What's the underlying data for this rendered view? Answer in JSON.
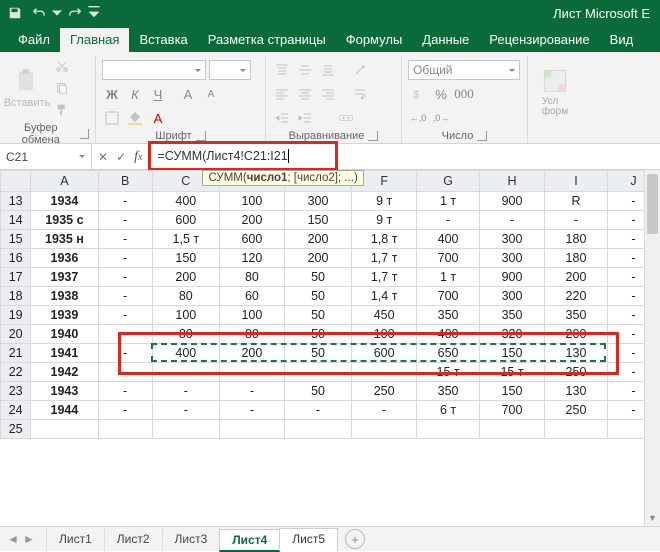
{
  "app": {
    "title": "Лист Microsoft E"
  },
  "qat": {
    "save": "save-icon",
    "undo": "undo-icon",
    "redo": "redo-icon",
    "customize": "customize-icon"
  },
  "tabs": {
    "file": "Файл",
    "home": "Главная",
    "insert": "Вставка",
    "layout": "Разметка страницы",
    "formulas": "Формулы",
    "data": "Данные",
    "review": "Рецензирование",
    "view": "Вид"
  },
  "ribbon": {
    "clipboard": {
      "label": "Буфер обмена",
      "paste": "Вставить"
    },
    "font": {
      "label": "Шрифт",
      "size_dash": "–",
      "bold": "Ж",
      "italic": "К",
      "underline": "Ч"
    },
    "alignment": {
      "label": "Выравнивание"
    },
    "number": {
      "label": "Число",
      "format": "Общий"
    },
    "styles": {
      "cond": "Условн форматир"
    }
  },
  "formula_bar": {
    "name_box": "C21",
    "formula": "=СУММ(Лист4!C21:I21",
    "tooltip_fn": "СУММ",
    "tooltip_arg1": "число1",
    "tooltip_rest": "; [число2]; ...)"
  },
  "columns": [
    "",
    "A",
    "B",
    "C",
    "D",
    "E",
    "F",
    "G",
    "H",
    "I",
    "J"
  ],
  "rows": [
    {
      "n": 13,
      "c": [
        "1934",
        "-",
        "400",
        "100",
        "300",
        "9 т",
        "1 т",
        "900",
        "R",
        "-"
      ]
    },
    {
      "n": 14,
      "c": [
        "1935 с",
        "-",
        "600",
        "200",
        "150",
        "9 т",
        "-",
        "-",
        "-",
        "-"
      ]
    },
    {
      "n": 15,
      "c": [
        "1935 н",
        "-",
        "1,5 т",
        "600",
        "200",
        "1,8 т",
        "400",
        "300",
        "180",
        "-"
      ]
    },
    {
      "n": 16,
      "c": [
        "1936",
        "-",
        "150",
        "120",
        "200",
        "1,7 т",
        "700",
        "300",
        "180",
        "-"
      ]
    },
    {
      "n": 17,
      "c": [
        "1937",
        "-",
        "200",
        "80",
        "50",
        "1,7 т",
        "1 т",
        "900",
        "200",
        "-"
      ]
    },
    {
      "n": 18,
      "c": [
        "1938",
        "-",
        "80",
        "60",
        "50",
        "1,4 т",
        "700",
        "300",
        "220",
        "-"
      ]
    },
    {
      "n": 19,
      "c": [
        "1939",
        "-",
        "100",
        "100",
        "50",
        "450",
        "350",
        "350",
        "350",
        "-"
      ]
    },
    {
      "n": 20,
      "c": [
        "1940",
        "-",
        "80",
        "80",
        "50",
        "100",
        "400",
        "320",
        "200",
        "-"
      ]
    },
    {
      "n": 21,
      "c": [
        "1941",
        "-",
        "400",
        "200",
        "50",
        "600",
        "650",
        "150",
        "130",
        "-"
      ]
    },
    {
      "n": 22,
      "c": [
        "1942",
        "-",
        "",
        "",
        "",
        "",
        "15 т",
        "15 т",
        "250",
        "-"
      ]
    },
    {
      "n": 23,
      "c": [
        "1943",
        "-",
        "-",
        "-",
        "50",
        "250",
        "350",
        "150",
        "130",
        "-"
      ]
    },
    {
      "n": 24,
      "c": [
        "1944",
        "-",
        "-",
        "-",
        "-",
        "-",
        "6 т",
        "700",
        "250",
        "-"
      ]
    },
    {
      "n": 25,
      "c": [
        "",
        "",
        "",
        "",
        "",
        "",
        "",
        "",
        "",
        ""
      ]
    }
  ],
  "sheets": {
    "items": [
      "Лист1",
      "Лист2",
      "Лист3",
      "Лист4",
      "Лист5"
    ],
    "active_index": 3
  }
}
